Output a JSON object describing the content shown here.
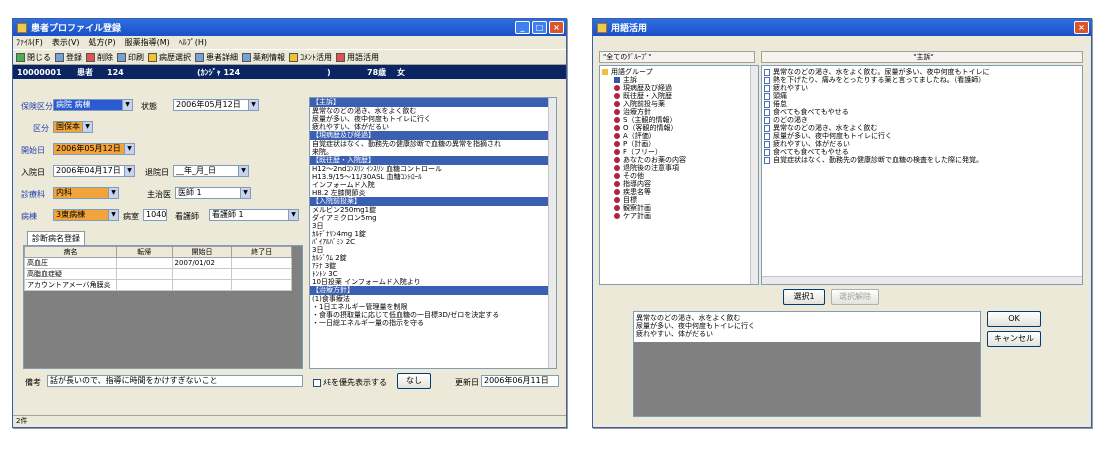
{
  "left_window": {
    "title": "患者プロファイル登録",
    "menu": [
      "ﾌｧｲﾙ(F)",
      "表示(V)",
      "処方(P)",
      "服薬指導(M)",
      "ﾍﾙﾌﾟ(H)"
    ],
    "toolbar": [
      {
        "label": "閉じる",
        "icon": "close-door-icon"
      },
      {
        "label": "登録",
        "icon": "save-icon"
      },
      {
        "label": "削除",
        "icon": "delete-icon"
      },
      {
        "label": "印刷",
        "icon": "print-icon"
      },
      {
        "label": "病歴選択",
        "icon": "history-icon"
      },
      {
        "label": "患者詳細",
        "icon": "patient-detail-icon"
      },
      {
        "label": "薬剤情報",
        "icon": "drug-info-icon"
      },
      {
        "label": "ｺﾒﾝﾄ活用",
        "icon": "comment-icon"
      },
      {
        "label": "用語活用",
        "icon": "term-icon"
      }
    ],
    "info": {
      "id": "10000001",
      "name": "患者",
      "number": "124",
      "kana": "(ｶﾝｼﾞｬ 124",
      "age": "78歳",
      "sex": "女"
    },
    "labels": {
      "kubun": "保険区分",
      "state": "状態",
      "hoken": "区分",
      "kaishi": "開始日",
      "nyuin": "入院日",
      "taiin": "退院日",
      "shinryo": "診療科",
      "shujii": "主治医",
      "byoto": "病棟",
      "byoshitsu": "病室",
      "kangoshi": "看護師"
    },
    "fields": {
      "kubun": "病院 病棟",
      "state_date": "2006年05月12日",
      "hoken": "国保本",
      "kaishi": "2006年05月12日",
      "nyuin": "2006年04月17日",
      "taiin": "__年_月_日",
      "shinryo": "内科",
      "shujii": "医師 1",
      "byoto": "3東病棟",
      "byoshitsu": "1040",
      "kangoshi": "看護師 1"
    },
    "tab": "診断病名登録",
    "grid_headers": [
      "病名",
      "転帰",
      "開始日",
      "終了日"
    ],
    "grid_rows": [
      [
        "高血圧",
        "",
        "2007/01/02",
        ""
      ],
      [
        "高脂血症疑",
        "",
        "",
        ""
      ],
      [
        "アカウントアメーバ角膜炎",
        "",
        "",
        ""
      ]
    ],
    "notes": [
      {
        "header": "【主訴】",
        "lines": [
          "異常なのどの渇き、水をよく飲む",
          "尿量が多い、夜中何度もトイレに行く",
          "疲れやすい、体がだるい"
        ]
      },
      {
        "header": "【現病歴及び経過】",
        "lines": [
          "自覚症状はなく、勤務先の健康診断で血糖の異常を指摘され",
          "来院。"
        ]
      },
      {
        "header": "【既往歴・入院歴】",
        "lines": [
          "H12～2ndｺﾝｽﾘﾝ ｲﾝｽﾘﾝ 血糖コントロール",
          "H13.9/15～11/30ASL 血糖ｺﾝﾄﾛｰﾙ",
          "インフォームド入院",
          "H8.2 左膝関節炎"
        ]
      },
      {
        "header": "【入院前投薬】",
        "lines": [
          "メルビン250mg1錠",
          "ダイアミクロン5mg",
          "   3日",
          "ｶﾙﾃﾞﾅﾘﾝ4mg 1錠",
          "ﾊﾟｲｱﾙﾊﾞﾐﾝ 2C",
          "   3日",
          "ｶﾙｼﾞｳﾑ 2錠",
          "ｱﾃﾅ 3錠",
          "ﾄﾝﾄﾝ 3C",
          "  10日投薬               インフォームド入院より"
        ]
      },
      {
        "header": "【治療方針】",
        "lines": [
          "(1)食事療法",
          " ・1日エネルギー管理量を制限",
          " ・食事の摂取量に応じて低血糖の一目標3D/ゼロを決定する",
          " ・一日総エネルギー量の指示を守る"
        ]
      }
    ],
    "biko_label": "備考",
    "biko_value": "話が長いので、指導に時間をかけすぎないこと",
    "checkbox_label": "ﾒﾓを優先表示する",
    "kari_btn": "なし",
    "koshin_label": "更新日",
    "koshin_value": "2006年06月11日",
    "status": "2件"
  },
  "right_window": {
    "title": "用語活用",
    "left_header": "\"全てのｸﾞﾙｰﾌﾟ\"",
    "right_header": "\"主訴\"",
    "tree_root": "用語グループ",
    "tree_items": [
      "主訴",
      "現病歴及び経過",
      "既往歴・入院歴",
      "入院前投与薬",
      "治療方針",
      "S（主観的情報）",
      "O（客観的情報）",
      "A（評価）",
      "P（計画）",
      "F（フリー）",
      "あなたのお薬の内容",
      "退院後の注意事項",
      "その他",
      "指導内容",
      "疾患名等",
      "目標",
      "観察計画",
      "ケア計画"
    ],
    "terms": [
      "異常なのどの渇き、水をよく飲む。尿量が多い、夜中何度もトイレに",
      "熱を下げたり、痛みをとったりする薬と言ってましたね。（看護師）",
      "疲れやすい",
      "頭痛",
      "倦怠",
      "食べても食べてもやせる",
      "のどの渇き",
      "異常なのどの渇き、水をよく飲む",
      "尿量が多い、夜中何度もトイレに行く",
      "疲れやすい、体がだるい",
      "食べても食べてもやせる",
      "自覚症状はなく、勤務先の健康診断で血糖の検査をした際に発覚。"
    ],
    "btn_select": "選択1",
    "btn_select_all": "選択解除",
    "preview_lines": [
      "異常なのどの渇き、水をよく飲む",
      "尿量が多い、夜中何度もトイレに行く",
      "疲れやすい、体がだるい"
    ],
    "btn_ok": "OK",
    "btn_cancel": "キャンセル"
  }
}
